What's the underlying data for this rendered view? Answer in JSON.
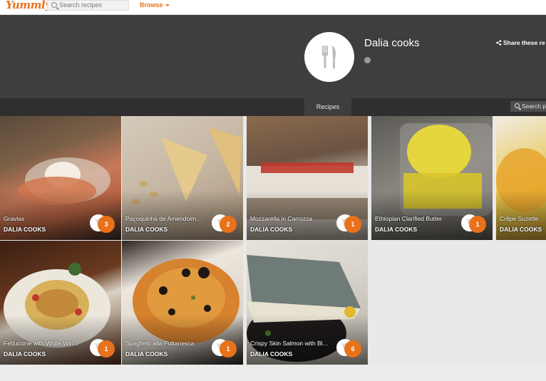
{
  "header": {
    "logo": "Yummly",
    "search_placeholder": "Search recipes",
    "browse_label": "Browse"
  },
  "profile": {
    "name": "Dalia cooks",
    "share_label": "Share these re"
  },
  "tabs": {
    "recipes_label": "Recipes",
    "search_placeholder": "Search p"
  },
  "recipes": [
    {
      "title": "Gravlax",
      "author": "DALIA COOKS",
      "yums": "3"
    },
    {
      "title": "Paçoquinha de Amendoim...",
      "author": "DALIA COOKS",
      "yums": "2"
    },
    {
      "title": "Mozzarella in Carrozza",
      "author": "DALIA COOKS",
      "yums": "1"
    },
    {
      "title": "Ethiopian Clarified Butter",
      "author": "DALIA COOKS",
      "yums": "1"
    },
    {
      "title": "Crêpe Suzette",
      "author": "DALIA COOKS",
      "yums": ""
    },
    {
      "title": "Fettuccine with White Win...",
      "author": "DALIA COOKS",
      "yums": "1"
    },
    {
      "title": "Spaghetti alla Puttanesca",
      "author": "DALIA COOKS",
      "yums": "1"
    },
    {
      "title": "Crispy Skin Salmon with Bl...",
      "author": "DALIA COOKS",
      "yums": "6"
    }
  ],
  "colors": {
    "brand_orange": "#e8711a",
    "hero_bg": "#3e3e3e",
    "tab_bg": "#2f2f2f"
  },
  "icons": {
    "avatar": "fork-knife-icon",
    "search": "search-icon",
    "globe": "globe-icon",
    "share": "share-icon",
    "yum": "yum-badge-icon"
  }
}
